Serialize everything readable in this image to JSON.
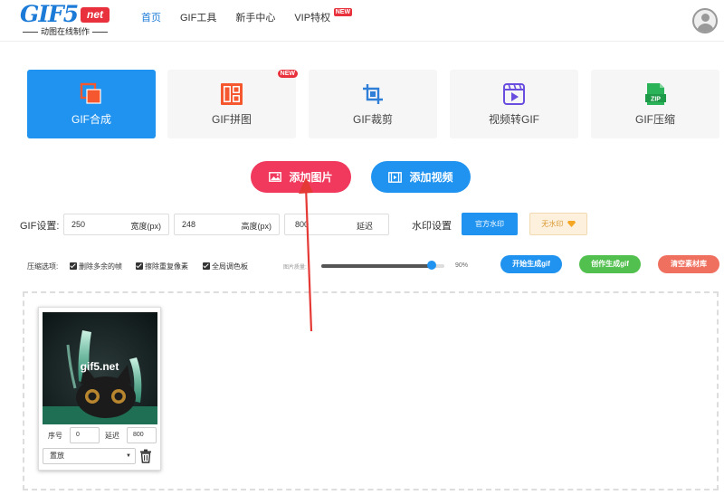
{
  "logo": {
    "main": "GIF5",
    "net": "net",
    "sub": "动图在线制作"
  },
  "nav": [
    {
      "label": "首页",
      "active": true
    },
    {
      "label": "GIF工具"
    },
    {
      "label": "新手中心"
    },
    {
      "label": "VIP特权",
      "badge": "NEW"
    }
  ],
  "tools": [
    {
      "label": "GIF合成",
      "icon": "layers-icon",
      "active": true
    },
    {
      "label": "GIF拼图",
      "icon": "collage-icon",
      "badge": "NEW"
    },
    {
      "label": "GIF裁剪",
      "icon": "crop-icon"
    },
    {
      "label": "视频转GIF",
      "icon": "video-play-icon"
    },
    {
      "label": "GIF压缩",
      "icon": "zip-icon",
      "icon_text": "ZIP"
    }
  ],
  "add_buttons": {
    "images": "添加图片",
    "video": "添加视频"
  },
  "gif_settings": {
    "label": "GIF设置:",
    "width": {
      "value": "250",
      "unit": "宽度(px)"
    },
    "height": {
      "value": "248",
      "unit": "高度(px)"
    },
    "delay": {
      "value": "800",
      "unit": "延迟"
    }
  },
  "watermark": {
    "label": "水印设置",
    "official": "官方水印",
    "none": "无水印"
  },
  "options": {
    "label": "压缩选项:",
    "items": [
      "删除多余的帧",
      "擦除重复像素",
      "全局调色板"
    ],
    "quality_label": "图片质量:",
    "quality_value": "90%",
    "quality_fraction": 0.9
  },
  "actions": {
    "start": "开始生成gif",
    "create": "创作生成gif",
    "clear": "清空素材库"
  },
  "frame": {
    "watermark_text": "gif5.net",
    "index_label": "序号",
    "index_value": "0",
    "delay_label": "延迟",
    "delay_value": "800",
    "dispose_value": "置放"
  },
  "colors": {
    "primary": "#1f93ef",
    "accent_red": "#f0395d",
    "green": "#52c04e",
    "orange": "#f0705f"
  }
}
